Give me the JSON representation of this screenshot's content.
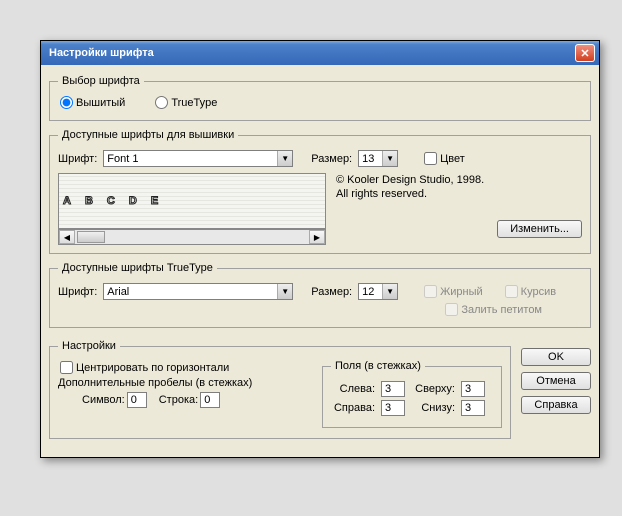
{
  "title": "Настройки шрифта",
  "close_x": "✕",
  "group1": {
    "legend": "Выбор шрифта",
    "opt_stitched": "Вышитый",
    "opt_truetype": "TrueType"
  },
  "group2": {
    "legend": "Доступные шрифты для вышивки",
    "font_label": "Шрифт:",
    "font_value": "Font 1",
    "size_label": "Размер:",
    "size_value": "13",
    "color_label": "Цвет",
    "copyright1": "© Kooler Design Studio, 1998.",
    "copyright2": "All rights reserved.",
    "change_btn": "Изменить...",
    "preview": "A B C D E"
  },
  "group3": {
    "legend": "Доступные шрифты TrueType",
    "font_label": "Шрифт:",
    "font_value": "Arial",
    "size_label": "Размер:",
    "size_value": "12",
    "bold_label": "Жирный",
    "italic_label": "Курсив",
    "petit_label": "Залить петитом"
  },
  "group4": {
    "legend": "Настройки",
    "center_h": "Центрировать по горизонтали",
    "extra_spaces": "Дополнительные пробелы (в стежках)",
    "symbol_label": "Символ:",
    "symbol_value": "0",
    "line_label": "Строка:",
    "line_value": "0",
    "margins": {
      "legend": "Поля (в стежках)",
      "left_label": "Слева:",
      "left_value": "3",
      "top_label": "Сверху:",
      "top_value": "3",
      "right_label": "Справа:",
      "right_value": "3",
      "bottom_label": "Снизу:",
      "bottom_value": "3"
    }
  },
  "buttons": {
    "ok": "OK",
    "cancel": "Отмена",
    "help": "Справка"
  },
  "arrow": "▼",
  "larr": "◀",
  "rarr": "▶"
}
